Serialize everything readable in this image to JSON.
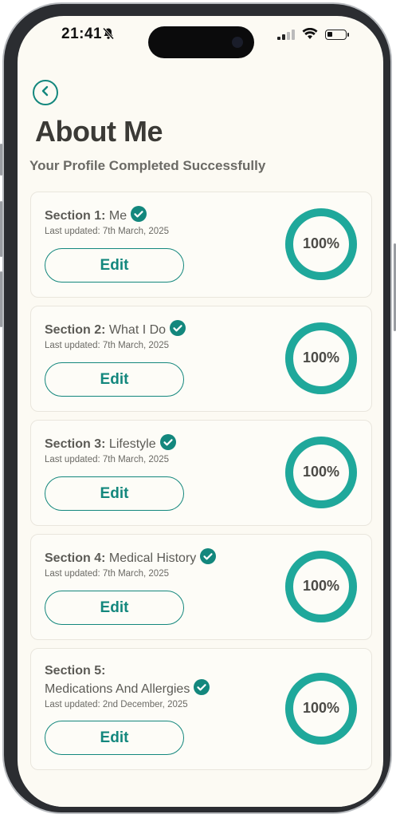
{
  "status": {
    "time": "21:41"
  },
  "header": {
    "title": "About Me",
    "subtitle": "Your Profile Completed Successfully"
  },
  "colors": {
    "accent": "#13877d",
    "ring": "#1fa89b",
    "background": "#fcfaf3"
  },
  "icons": {
    "back": "chevron-left-icon",
    "check": "check-circle-icon",
    "bell": "bell-slash-icon"
  },
  "sections": [
    {
      "prefix": "Section 1:",
      "name": "Me",
      "updated": "Last updated: 7th March, 2025",
      "edit": "Edit",
      "progress_label": "100%",
      "progress": 100
    },
    {
      "prefix": "Section 2:",
      "name": "What I Do",
      "updated": "Last updated: 7th March, 2025",
      "edit": "Edit",
      "progress_label": "100%",
      "progress": 100
    },
    {
      "prefix": "Section 3:",
      "name": "Lifestyle",
      "updated": "Last updated: 7th March, 2025",
      "edit": "Edit",
      "progress_label": "100%",
      "progress": 100
    },
    {
      "prefix": "Section 4:",
      "name": "Medical History",
      "updated": "Last updated: 7th March, 2025",
      "edit": "Edit",
      "progress_label": "100%",
      "progress": 100
    },
    {
      "prefix": "Section 5:",
      "name": "Medications And Allergies",
      "updated": "Last updated: 2nd December, 2025",
      "edit": "Edit",
      "progress_label": "100%",
      "progress": 100
    }
  ]
}
